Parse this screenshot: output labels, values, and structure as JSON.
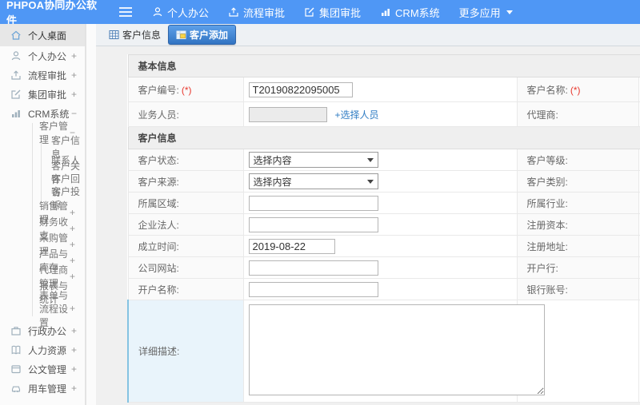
{
  "topbar": {
    "brand": "PHPOA协同办公软件",
    "nav": [
      {
        "label": "个人办公",
        "icon": "user-icon"
      },
      {
        "label": "流程审批",
        "icon": "flow-icon"
      },
      {
        "label": "集团审批",
        "icon": "edit-icon"
      },
      {
        "label": "CRM系统",
        "icon": "bar-chart-icon"
      },
      {
        "label": "更多应用",
        "icon": "caret-down-icon"
      }
    ]
  },
  "sidebar": {
    "items": [
      {
        "label": "个人桌面",
        "icon": "home-icon",
        "active": true
      },
      {
        "label": "个人办公",
        "icon": "user-icon",
        "expand": "+"
      },
      {
        "label": "流程审批",
        "icon": "flow-icon",
        "expand": "+"
      },
      {
        "label": "集团审批",
        "icon": "edit-icon",
        "expand": "+"
      },
      {
        "label": "CRM系统",
        "icon": "bar-chart-icon",
        "expand": "−"
      },
      {
        "label": "行政办公",
        "icon": "briefcase-icon",
        "expand": "+"
      },
      {
        "label": "人力资源",
        "icon": "book-icon",
        "expand": "+"
      },
      {
        "label": "公文管理",
        "icon": "document-icon",
        "expand": "+"
      },
      {
        "label": "用车管理",
        "icon": "car-icon",
        "expand": "+"
      }
    ],
    "tree": [
      {
        "label": "客户管理",
        "expand": "−",
        "children": [
          "客户信息",
          "联系人",
          "客户关怀",
          "客户回访",
          "客户投诉"
        ]
      },
      {
        "label": "销售管理",
        "expand": "+"
      },
      {
        "label": "财务收支",
        "expand": "+"
      },
      {
        "label": "采购管理",
        "expand": "+"
      },
      {
        "label": "产品与库存",
        "expand": "+"
      },
      {
        "label": "代理商管理",
        "expand": "+"
      },
      {
        "label": "报表与统计",
        "expand": ""
      },
      {
        "label": "表单与流程设置",
        "expand": "+"
      }
    ]
  },
  "tabs": [
    {
      "label": "客户信息",
      "icon": "table-icon",
      "active": false
    },
    {
      "label": "客户添加",
      "icon": "add-customer-icon",
      "active": true
    }
  ],
  "form": {
    "sections": [
      {
        "title": "基本信息",
        "rows": [
          {
            "left": {
              "label": "客户编号:",
              "required": "(*)",
              "type": "text",
              "value": "T20190822095005"
            },
            "right": {
              "label": "客户名称:",
              "required": "(*)"
            }
          },
          {
            "left": {
              "label": "业务人员:",
              "type": "text-disabled",
              "value": "",
              "link": "+选择人员"
            },
            "right": {
              "label": "代理商:"
            }
          }
        ]
      },
      {
        "title": "客户信息",
        "rows": [
          {
            "left": {
              "label": "客户状态:",
              "type": "select",
              "value": "选择内容"
            },
            "right": {
              "label": "客户等级:"
            }
          },
          {
            "left": {
              "label": "客户来源:",
              "type": "select",
              "value": "选择内容"
            },
            "right": {
              "label": "客户类别:"
            }
          },
          {
            "left": {
              "label": "所属区域:",
              "type": "text",
              "value": ""
            },
            "right": {
              "label": "所属行业:"
            }
          },
          {
            "left": {
              "label": "企业法人:",
              "type": "text",
              "value": ""
            },
            "right": {
              "label": "注册资本:"
            }
          },
          {
            "left": {
              "label": "成立时间:",
              "type": "date",
              "value": "2019-08-22"
            },
            "right": {
              "label": "注册地址:"
            }
          },
          {
            "left": {
              "label": "公司网站:",
              "type": "text",
              "value": ""
            },
            "right": {
              "label": "开户行:"
            }
          },
          {
            "left": {
              "label": "开户名称:",
              "type": "text",
              "value": ""
            },
            "right": {
              "label": "银行账号:"
            }
          },
          {
            "left": {
              "label": "详细描述:",
              "type": "textarea",
              "value": ""
            },
            "right": {
              "label": ""
            }
          }
        ]
      }
    ]
  },
  "colors": {
    "topbar": "#4f97f5",
    "active_tab": "#3173c2",
    "link": "#2f7cc3",
    "required": "#e8392f",
    "highlight_row": "#e9f4fb"
  }
}
